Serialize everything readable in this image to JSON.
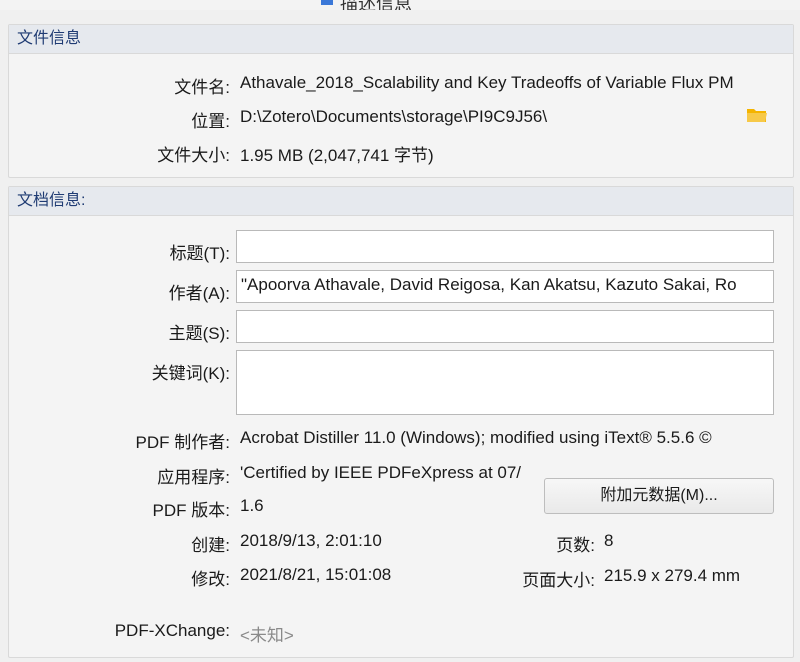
{
  "window": {
    "title": "描述信息"
  },
  "file_info": {
    "header": "文件信息",
    "filename_label": "文件名:",
    "filename_value": "Athavale_2018_Scalability and Key Tradeoffs of Variable Flux PM",
    "location_label": "位置:",
    "location_value": "D:\\Zotero\\Documents\\storage\\PI9C9J56\\",
    "size_label": "文件大小:",
    "size_value": "1.95 MB (2,047,741 字节)",
    "folder_icon": "folder-icon"
  },
  "doc_info": {
    "header": "文档信息:",
    "title_label": "标题(T):",
    "title_value": "",
    "author_label": "作者(A):",
    "author_value": "\"Apoorva Athavale, David Reigosa, Kan Akatsu, Kazuto Sakai, Ro",
    "subject_label": "主题(S):",
    "subject_value": "",
    "keywords_label": "关键词(K):",
    "keywords_value": "",
    "producer_label": "PDF 制作者:",
    "producer_value": "Acrobat Distiller 11.0 (Windows); modified using iText® 5.5.6 ©",
    "application_label": "应用程序:",
    "application_value": "'Certified by IEEE PDFeXpress at 07/",
    "pdf_version_label": "PDF 版本:",
    "pdf_version_value": "1.6",
    "metadata_button": "附加元数据(M)...",
    "created_label": "创建:",
    "created_value": "2018/9/13, 2:01:10",
    "modified_label": "修改:",
    "modified_value": "2021/8/21, 15:01:08",
    "pages_label": "页数:",
    "pages_value": "8",
    "page_size_label": "页面大小:",
    "page_size_value": "215.9 x 279.4 mm",
    "pdfxchange_label": "PDF-XChange:",
    "pdfxchange_value": "<未知>"
  }
}
